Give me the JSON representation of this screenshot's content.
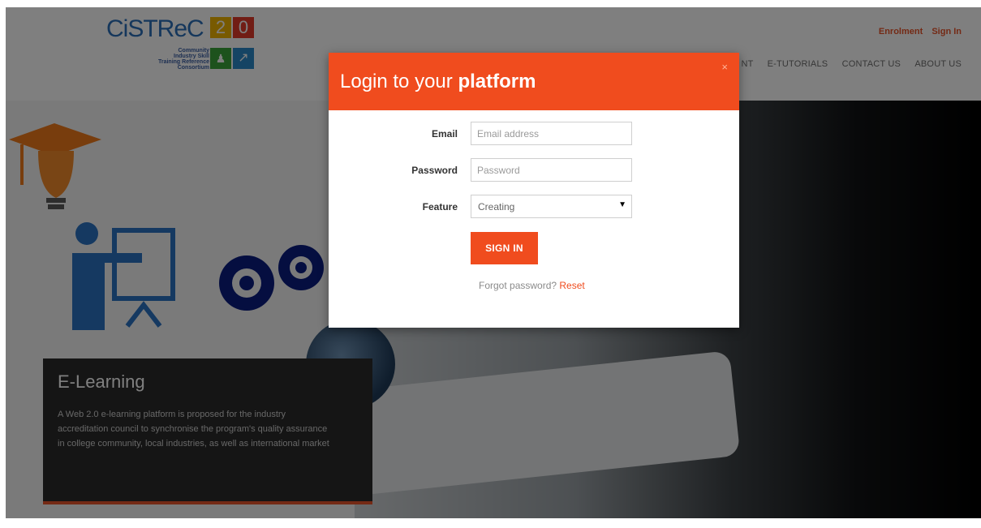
{
  "logo": {
    "word": "CiSTReC",
    "version_tiles": [
      "2",
      ".",
      "0"
    ],
    "subtitle_lines": [
      "Community",
      "Industry Skill",
      "Training Reference",
      "Consortium"
    ]
  },
  "topnav": {
    "enrolment": "Enrolment",
    "sign_in": "Sign In"
  },
  "mainnav": {
    "items": [
      "NT",
      "E-TUTORIALS",
      "CONTACT US",
      "ABOUT US"
    ]
  },
  "hero": {
    "card_title": "E-Learning",
    "card_text": "A Web 2.0 e-learning platform is proposed for the industry accreditation council to synchronise the program's quality assurance in college community, local industries, as well as international market"
  },
  "modal": {
    "title_prefix": "Login to your",
    "title_bold": "platform",
    "close": "×",
    "email_label": "Email",
    "email_placeholder": "Email address",
    "password_label": "Password",
    "password_placeholder": "Password",
    "feature_label": "Feature",
    "feature_value": "Creating",
    "signin_label": "SIGN IN",
    "forgot_text": "Forgot password?",
    "reset_text": "Reset"
  },
  "colors": {
    "accent": "#f04c1e",
    "logo_blue": "#2b6fb8"
  },
  "icons": [
    "graduation-cap-lightbulb-icon",
    "presenter-icon",
    "gears-icon",
    "close-icon",
    "dropdown-caret-icon"
  ]
}
